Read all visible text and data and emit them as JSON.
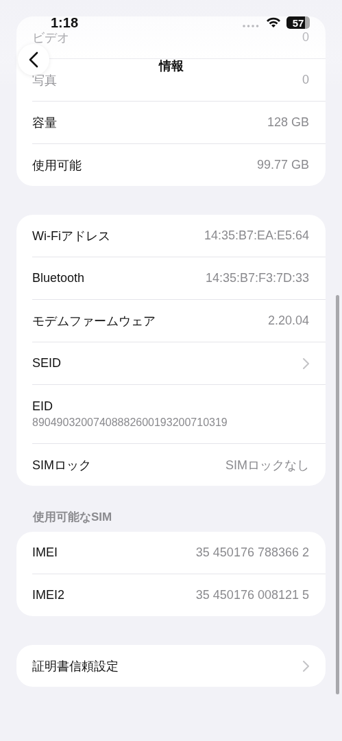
{
  "status_bar": {
    "time": "1:18",
    "battery": "57"
  },
  "nav": {
    "title": "情報"
  },
  "groups": [
    {
      "rows": [
        {
          "kind": "value",
          "label": "ビデオ",
          "value": "0",
          "faded": true
        },
        {
          "kind": "value",
          "label": "写真",
          "value": "0",
          "faded": true
        },
        {
          "kind": "value",
          "label": "容量",
          "value": "128 GB",
          "faded": false
        },
        {
          "kind": "value",
          "label": "使用可能",
          "value": "99.77 GB",
          "faded": false
        }
      ]
    },
    {
      "rows": [
        {
          "kind": "value",
          "label": "Wi-Fiアドレス",
          "value": "14:35:B7:EA:E5:64",
          "faded": false
        },
        {
          "kind": "value",
          "label": "Bluetooth",
          "value": "14:35:B7:F3:7D:33",
          "faded": false
        },
        {
          "kind": "value",
          "label": "モデムファームウェア",
          "value": "2.20.04",
          "faded": false
        },
        {
          "kind": "chevron",
          "label": "SEID",
          "faded": false
        },
        {
          "kind": "stacked",
          "label": "EID",
          "value": "89049032007408882600193200710319",
          "faded": false
        },
        {
          "kind": "value",
          "label": "SIMロック",
          "value": "SIMロックなし",
          "faded": false
        }
      ]
    },
    {
      "header": "使用可能なSIM",
      "rows": [
        {
          "kind": "value",
          "label": "IMEI",
          "value": "35 450176 788366 2",
          "faded": false
        },
        {
          "kind": "value",
          "label": "IMEI2",
          "value": "35 450176 008121 5",
          "faded": false
        }
      ]
    },
    {
      "rows": [
        {
          "kind": "chevron",
          "label": "証明書信頼設定",
          "faded": false
        }
      ]
    }
  ]
}
